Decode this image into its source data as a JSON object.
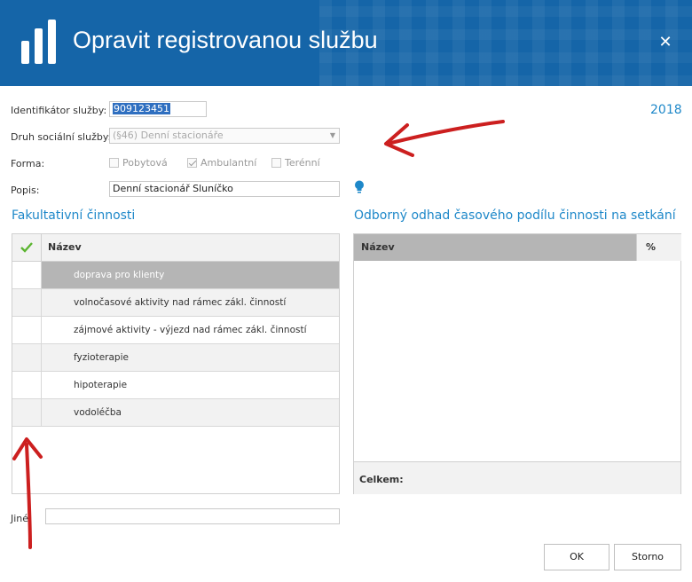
{
  "header": {
    "title": "Opravit registrovanou službu",
    "logo_icon": "bar-chart-icon",
    "close_icon": "close-icon",
    "close_glyph": "✕",
    "bg_color": "#1565a8"
  },
  "form": {
    "service_id": {
      "label": "Identifikátor služby:",
      "value": "909123451"
    },
    "service_type": {
      "label": "Druh sociální služby:",
      "value": "(§46) Denní stacionáře"
    },
    "form_type": {
      "label": "Forma:",
      "options": [
        {
          "label": "Pobytová",
          "checked": false
        },
        {
          "label": "Ambulantní",
          "checked": true
        },
        {
          "label": "Terénní",
          "checked": false
        }
      ]
    },
    "description": {
      "label": "Popis:",
      "value": "Denní stacionář Sluníčko"
    },
    "other": {
      "label": "Jiné",
      "value": ""
    }
  },
  "year": "2018",
  "optional_activities": {
    "title": "Fakultativní činnosti",
    "column": "Název",
    "rows": [
      "doprava pro klienty",
      "volnočasové aktivity nad rámec zákl. činností",
      "zájmové aktivity - výjezd nad rámec zákl. činností",
      "fyzioterapie",
      "hipoterapie",
      "vodoléčba"
    ],
    "selected_index": 0
  },
  "expert_estimate": {
    "title": "Odborný odhad časového podílu činnosti na setkání",
    "col_name": "Název",
    "col_pct": "%",
    "total_label": "Celkem:"
  },
  "buttons": {
    "ok": "OK",
    "cancel": "Storno"
  },
  "colors": {
    "accent": "#1e88c9",
    "arrow": "#cc1f1f"
  }
}
